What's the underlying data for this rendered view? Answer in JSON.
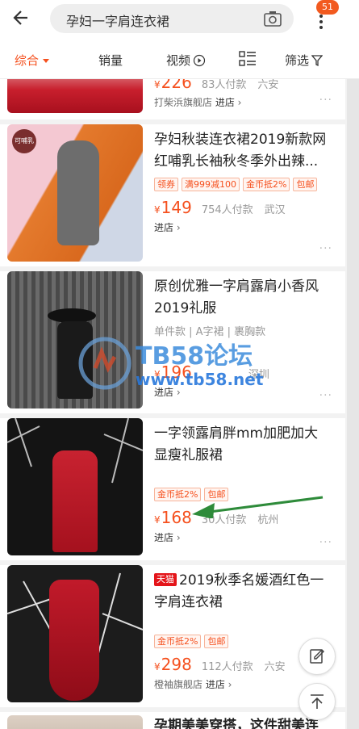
{
  "search": {
    "query": "孕妇一字肩连衣裙",
    "cart_badge": "51"
  },
  "sort": {
    "items": [
      "综合",
      "销量",
      "视频",
      "筛选"
    ]
  },
  "products": [
    {
      "price": "226",
      "sold": "83人付款",
      "location": "六安",
      "shop": "打柴浜旗舰店",
      "enter": "进店"
    },
    {
      "title": "孕妇秋装连衣裙2019新款网红哺乳长袖秋冬季外出辣...",
      "tags": [
        "领券",
        "满999减100",
        "金币抵2%",
        "包邮"
      ],
      "price": "149",
      "sold": "754人付款",
      "location": "武汉",
      "enter": "进店",
      "thumb_label": "可哺乳"
    },
    {
      "title": "原创优雅一字肩露肩小香风2019礼服",
      "attrs": "单件款 | A字裙 | 裹胸款",
      "price": "196",
      "sold": "",
      "location": "深圳",
      "enter": "进店"
    },
    {
      "title": "一字领露肩胖mm加肥加大显瘦礼服裙",
      "tags": [
        "金币抵2%",
        "包邮"
      ],
      "price": "168",
      "sold": "30人付款",
      "location": "杭州",
      "enter": "进店"
    },
    {
      "tmall": "天猫",
      "title": "2019秋季名媛酒红色一字肩连衣裙",
      "tags": [
        "金币抵2%",
        "包邮"
      ],
      "price": "298",
      "sold": "112人付款",
      "location": "六安",
      "shop": "橙袖旗舰店",
      "enter": "进店"
    },
    {
      "title": "孕期美美穿搭，这件甜美连"
    }
  ],
  "currency": "¥",
  "watermark": {
    "line1": "TB58论坛",
    "line2": "www.tb58.net"
  },
  "colors": {
    "accent": "#f5501e"
  }
}
